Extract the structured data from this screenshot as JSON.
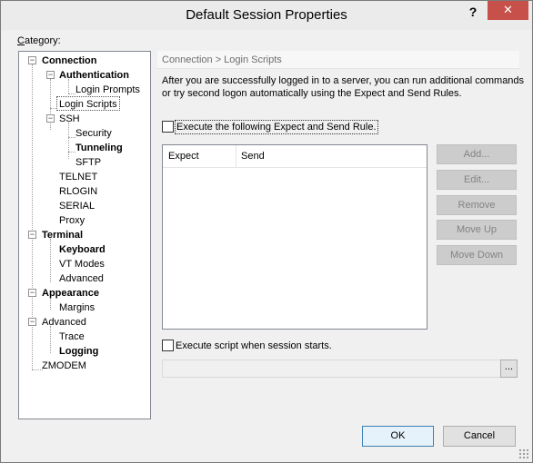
{
  "window": {
    "title": "Default Session Properties",
    "help_label": "?",
    "close_label": "✕"
  },
  "category": {
    "label_prefix": "C",
    "label_rest": "ategory:"
  },
  "tree": {
    "connection": "Connection",
    "authentication": "Authentication",
    "login_prompts": "Login Prompts",
    "login_scripts": "Login Scripts",
    "ssh": "SSH",
    "security": "Security",
    "tunneling": "Tunneling",
    "sftp": "SFTP",
    "telnet": "TELNET",
    "rlogin": "RLOGIN",
    "serial": "SERIAL",
    "proxy": "Proxy",
    "terminal": "Terminal",
    "keyboard": "Keyboard",
    "vt_modes": "VT Modes",
    "advanced_terminal": "Advanced",
    "appearance": "Appearance",
    "margins": "Margins",
    "advanced": "Advanced",
    "trace": "Trace",
    "logging": "Logging",
    "zmodem": "ZMODEM"
  },
  "panel": {
    "header": "Connection > Login Scripts",
    "description": "After you are successfully logged in to a server, you can run additional commands or try second logon automatically using the Expect and Send Rules.",
    "execute_rule_label": "Execute the following Expect and Send Rule.",
    "execute_rule_checked": false,
    "columns": [
      "Expect",
      "Send"
    ],
    "buttons": {
      "add": "Add...",
      "edit": "Edit...",
      "remove": "Remove",
      "move_up": "Move Up",
      "move_down": "Move Down"
    },
    "execute_script_label": "Execute script when session starts.",
    "execute_script_checked": false,
    "script_path": "",
    "browse_label": "..."
  },
  "footer": {
    "ok": "OK",
    "cancel": "Cancel"
  }
}
